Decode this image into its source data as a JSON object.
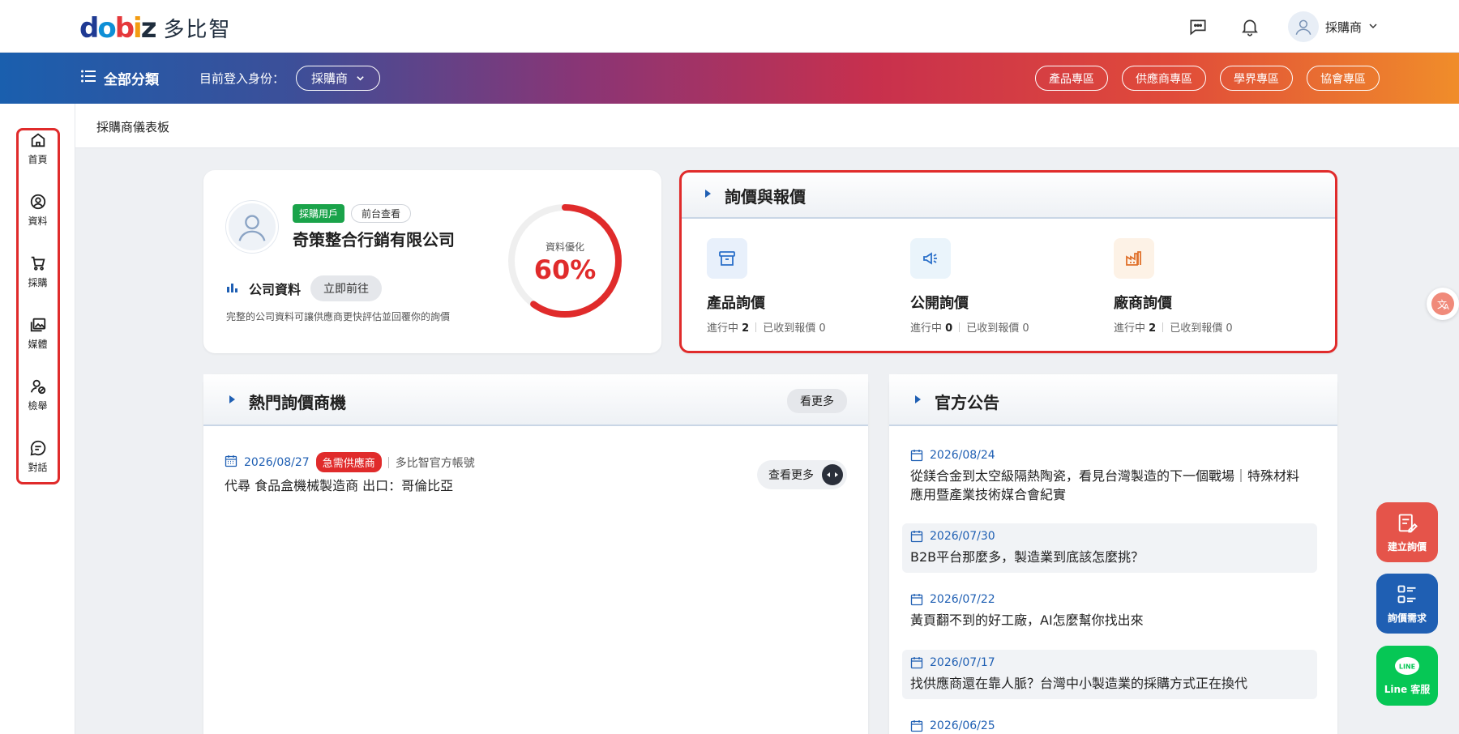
{
  "brand": {
    "logo_text": "dobiz",
    "name": "多比智"
  },
  "header": {
    "user_role": "採購商"
  },
  "nav": {
    "menu_label": "全部分類",
    "role_label": "目前登入身份：",
    "role_value": "採購商",
    "links": [
      "產品專區",
      "供應商專區",
      "學界專區",
      "協會專區"
    ]
  },
  "sidebar": {
    "items": [
      {
        "label": "首頁",
        "icon": "home-icon"
      },
      {
        "label": "資料",
        "icon": "profile-icon"
      },
      {
        "label": "採購",
        "icon": "cart-icon"
      },
      {
        "label": "媒體",
        "icon": "media-icon"
      },
      {
        "label": "檢舉",
        "icon": "report-icon"
      },
      {
        "label": "對話",
        "icon": "chat-icon"
      }
    ]
  },
  "breadcrumb": "採購商儀表板",
  "profile": {
    "badge_role": "採購用戶",
    "badge_view": "前台查看",
    "company_name": "奇策整合行銷有限公司",
    "section_label": "公司資料",
    "go_button": "立即前往",
    "description": "完整的公司資料可讓供應商更快評估並回覆你的詢價",
    "gauge_label": "資料優化",
    "gauge_value": "60%",
    "gauge_percent": 60
  },
  "inquiry": {
    "title": "詢價與報價",
    "items": [
      {
        "title": "產品詢價",
        "in_progress_label": "進行中",
        "in_progress": "2",
        "received_label": "已收到報價",
        "received": "0"
      },
      {
        "title": "公開詢價",
        "in_progress_label": "進行中",
        "in_progress": "0",
        "received_label": "已收到報價",
        "received": "0"
      },
      {
        "title": "廠商詢價",
        "in_progress_label": "進行中",
        "in_progress": "2",
        "received_label": "已收到報價",
        "received": "0"
      }
    ]
  },
  "hot": {
    "title": "熱門詢價商機",
    "more_label": "看更多",
    "item": {
      "date": "2026/08/27",
      "tag": "急需供應商",
      "source": "多比智官方帳號",
      "title": "代尋 食品盒機械製造商 出口：哥倫比亞",
      "detail_label": "查看更多"
    }
  },
  "news": {
    "title": "官方公告",
    "items": [
      {
        "date": "2026/08/24",
        "title": "從鎂合金到太空級隔熱陶瓷，看見台灣製造的下一個戰場｜特殊材料應用暨產業技術媒合會紀實"
      },
      {
        "date": "2026/07/30",
        "title": "B2B平台那麼多，製造業到底該怎麼挑？"
      },
      {
        "date": "2026/07/22",
        "title": "黃頁翻不到的好工廠，AI怎麼幫你找出來"
      },
      {
        "date": "2026/07/17",
        "title": "找供應商還在靠人脈？台灣中小製造業的採購方式正在換代"
      },
      {
        "date": "2026/06/25",
        "title": ""
      }
    ]
  },
  "fabs": {
    "create_inquiry": "建立詢價",
    "inquiry_needs": "詢價需求",
    "line_service": "Line 客服",
    "line_badge": "LINE"
  },
  "colors": {
    "accent_red": "#e02b2b",
    "primary_blue": "#1f5fb3",
    "line_green": "#06c755"
  }
}
